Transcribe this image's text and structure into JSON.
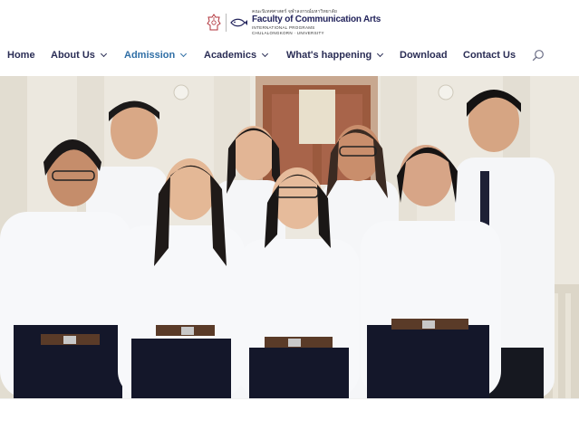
{
  "header": {
    "thai_line": "คณะนิเทศศาสตร์ จุฬาลงกรณ์มหาวิทยาลัย",
    "title": "Faculty of Communication Arts",
    "program": "INTERNATIONAL PROGRAMS",
    "university": "CHULALONGKORN · UNIVERSITY"
  },
  "nav": {
    "items": [
      {
        "label": "Home",
        "dropdown": false
      },
      {
        "label": "About Us",
        "dropdown": true
      },
      {
        "label": "Admission",
        "dropdown": true,
        "active": true
      },
      {
        "label": "Academics",
        "dropdown": true
      },
      {
        "label": "What's happening",
        "dropdown": true
      },
      {
        "label": "Download",
        "dropdown": false
      },
      {
        "label": "Contact Us",
        "dropdown": false
      }
    ],
    "search_icon": "search-icon"
  },
  "colors": {
    "nav_text": "#2a2d55",
    "nav_active": "#2f6ea5",
    "brand_navy": "#23245c",
    "brand_red": "#b0323a"
  },
  "hero": {
    "image_description": ""
  }
}
